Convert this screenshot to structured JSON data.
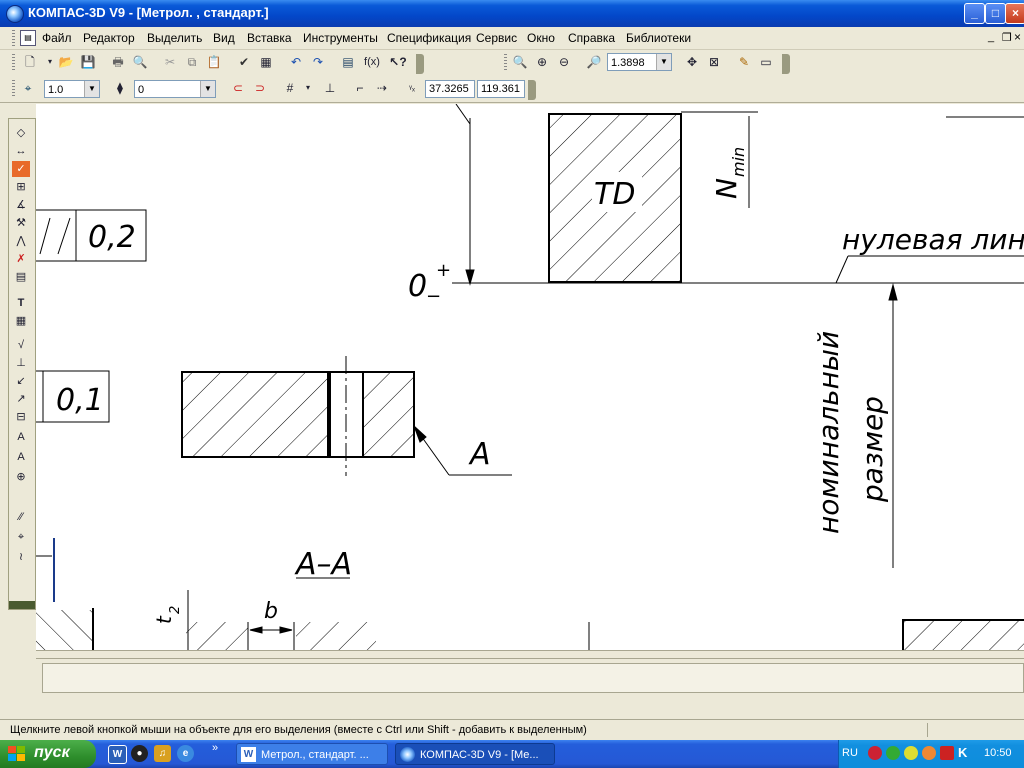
{
  "window": {
    "title": "КОМПАС-3D V9 - [Метрол. , стандарт.]"
  },
  "menu": [
    "Файл",
    "Редактор",
    "Выделить",
    "Вид",
    "Вставка",
    "Инструменты",
    "Спецификация",
    "Сервис",
    "Окно",
    "Справка",
    "Библиотеки"
  ],
  "toolbar": {
    "zoom_value": "1.3898",
    "line_style_value": "1.0",
    "layer_value": "0",
    "coord_x": "37.3265",
    "coord_y": "119.361",
    "fx_label": "f(x)"
  },
  "drawing": {
    "label_td": "TD",
    "label_nmin": "N",
    "label_nmin_sub": "min",
    "label_zero": "0",
    "label_plus": "+",
    "label_minus": "−",
    "label_zero_line": "нулевая линия",
    "label_nominal_1": "номинальный",
    "label_nominal_2": "размер",
    "label_tol_02": "0,2",
    "label_tol_01": "0,1",
    "label_a": "A",
    "label_section": "A–A",
    "label_b": "b",
    "label_t2": "t",
    "label_t2_sub": "2"
  },
  "status": {
    "hint": "Щелкните левой кнопкой мыши на объекте для его выделения (вместе с Ctrl или Shift - добавить к выделенным)"
  },
  "taskbar": {
    "start_label": "пуск",
    "task1": "Метрол., стандарт. ...",
    "task2": "КОМПАС-3D V9 - [Ме...",
    "lang": "RU",
    "clock": "10:50"
  }
}
